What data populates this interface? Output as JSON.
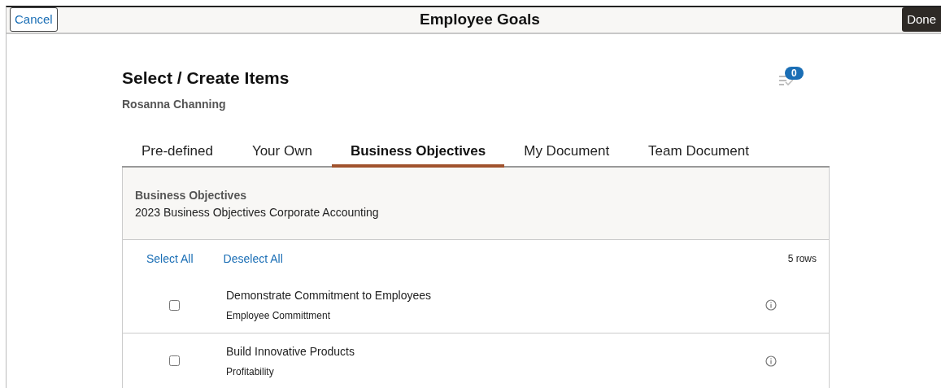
{
  "header": {
    "title": "Employee Goals",
    "cancel": "Cancel",
    "done": "Done"
  },
  "page": {
    "title": "Select / Create Items",
    "subtitle": "Rosanna Channing",
    "badge": "0"
  },
  "tabs": [
    {
      "label": "Pre-defined",
      "selected": false
    },
    {
      "label": "Your Own",
      "selected": false
    },
    {
      "label": "Business Objectives",
      "selected": true
    },
    {
      "label": "My Document",
      "selected": false
    },
    {
      "label": "Team Document",
      "selected": false
    }
  ],
  "section": {
    "heading": "Business Objectives",
    "description": "2023 Business Objectives Corporate Accounting"
  },
  "actions": {
    "select_all": "Select All",
    "deselect_all": "Deselect All",
    "count": "5 rows"
  },
  "items": [
    {
      "title": "Demonstrate Commitment to Employees",
      "category": "Employee Committment",
      "checked": false
    },
    {
      "title": "Build Innovative Products",
      "category": "Profitability",
      "checked": false
    }
  ]
}
